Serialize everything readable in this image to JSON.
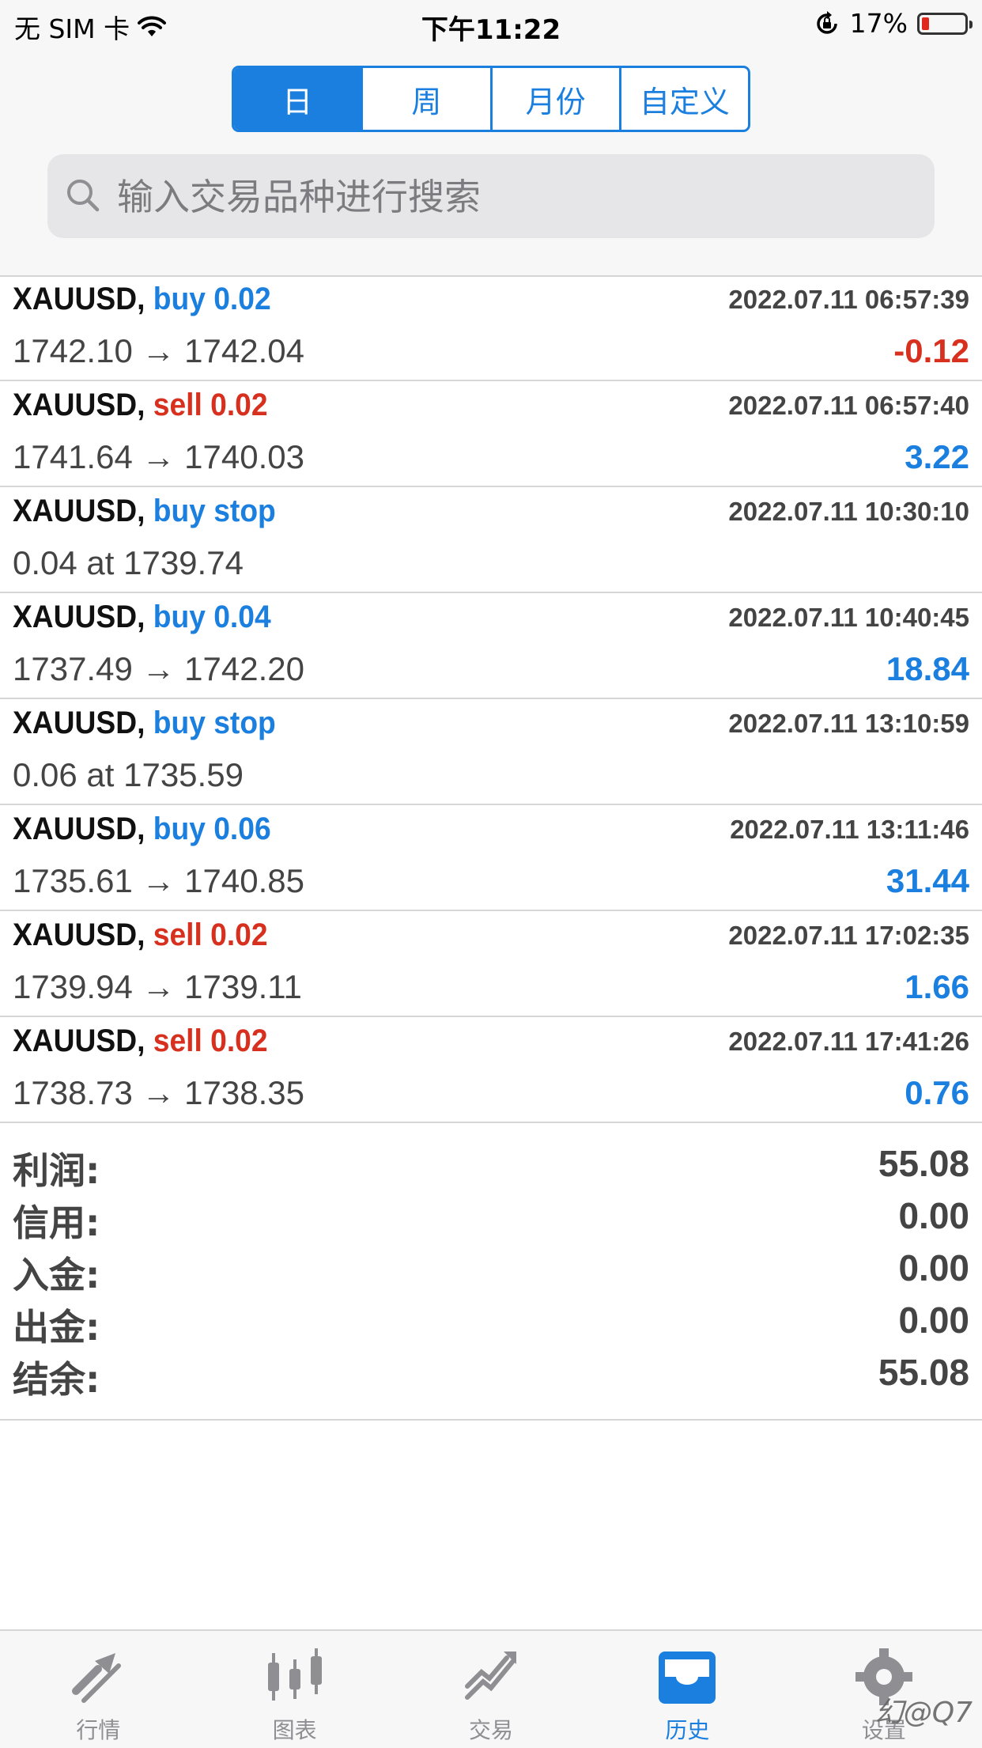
{
  "status_bar": {
    "carrier": "无 SIM 卡",
    "time": "下午11:22",
    "battery_percent": "17%",
    "battery_level": 0.17
  },
  "period_tabs": [
    "日",
    "周",
    "月份",
    "自定义"
  ],
  "active_period": 0,
  "search": {
    "placeholder": "输入交易品种进行搜索"
  },
  "deals": [
    {
      "symbol": "XAUUSD,",
      "side": "buy 0.02",
      "side_type": "buy",
      "time": "2022.07.11 06:57:39",
      "detail": "1742.10 → 1742.04",
      "profit": "-0.12",
      "profit_sign": "neg"
    },
    {
      "symbol": "XAUUSD,",
      "side": "sell 0.02",
      "side_type": "sell",
      "time": "2022.07.11 06:57:40",
      "detail": "1741.64 → 1740.03",
      "profit": "3.22",
      "profit_sign": "pos"
    },
    {
      "symbol": "XAUUSD,",
      "side": "buy stop",
      "side_type": "buy",
      "time": "2022.07.11 10:30:10",
      "detail": "0.04 at 1739.74",
      "profit": "",
      "profit_sign": ""
    },
    {
      "symbol": "XAUUSD,",
      "side": "buy 0.04",
      "side_type": "buy",
      "time": "2022.07.11 10:40:45",
      "detail": "1737.49 → 1742.20",
      "profit": "18.84",
      "profit_sign": "pos"
    },
    {
      "symbol": "XAUUSD,",
      "side": "buy stop",
      "side_type": "buy",
      "time": "2022.07.11 13:10:59",
      "detail": "0.06 at 1735.59",
      "profit": "",
      "profit_sign": ""
    },
    {
      "symbol": "XAUUSD,",
      "side": "buy 0.06",
      "side_type": "buy",
      "time": "2022.07.11 13:11:46",
      "detail": "1735.61 → 1740.85",
      "profit": "31.44",
      "profit_sign": "pos"
    },
    {
      "symbol": "XAUUSD,",
      "side": "sell 0.02",
      "side_type": "sell",
      "time": "2022.07.11 17:02:35",
      "detail": "1739.94 → 1739.11",
      "profit": "1.66",
      "profit_sign": "pos"
    },
    {
      "symbol": "XAUUSD,",
      "side": "sell 0.02",
      "side_type": "sell",
      "time": "2022.07.11 17:41:26",
      "detail": "1738.73 → 1738.35",
      "profit": "0.76",
      "profit_sign": "pos"
    }
  ],
  "summary": [
    {
      "label": "利润:",
      "value": "55.08"
    },
    {
      "label": "信用:",
      "value": "0.00"
    },
    {
      "label": "入金:",
      "value": "0.00"
    },
    {
      "label": "出金:",
      "value": "0.00"
    },
    {
      "label": "结余:",
      "value": "55.08"
    }
  ],
  "tabbar": [
    {
      "label": "行情",
      "icon": "quotes-icon"
    },
    {
      "label": "图表",
      "icon": "chart-icon"
    },
    {
      "label": "交易",
      "icon": "trade-icon"
    },
    {
      "label": "历史",
      "icon": "history-icon"
    },
    {
      "label": "设置",
      "icon": "settings-icon"
    }
  ],
  "active_tab": 3,
  "watermark": "幻@Q7",
  "colors": {
    "accent": "#1b7fe0",
    "loss": "#d8301f",
    "battery_low": "#e0281f"
  }
}
